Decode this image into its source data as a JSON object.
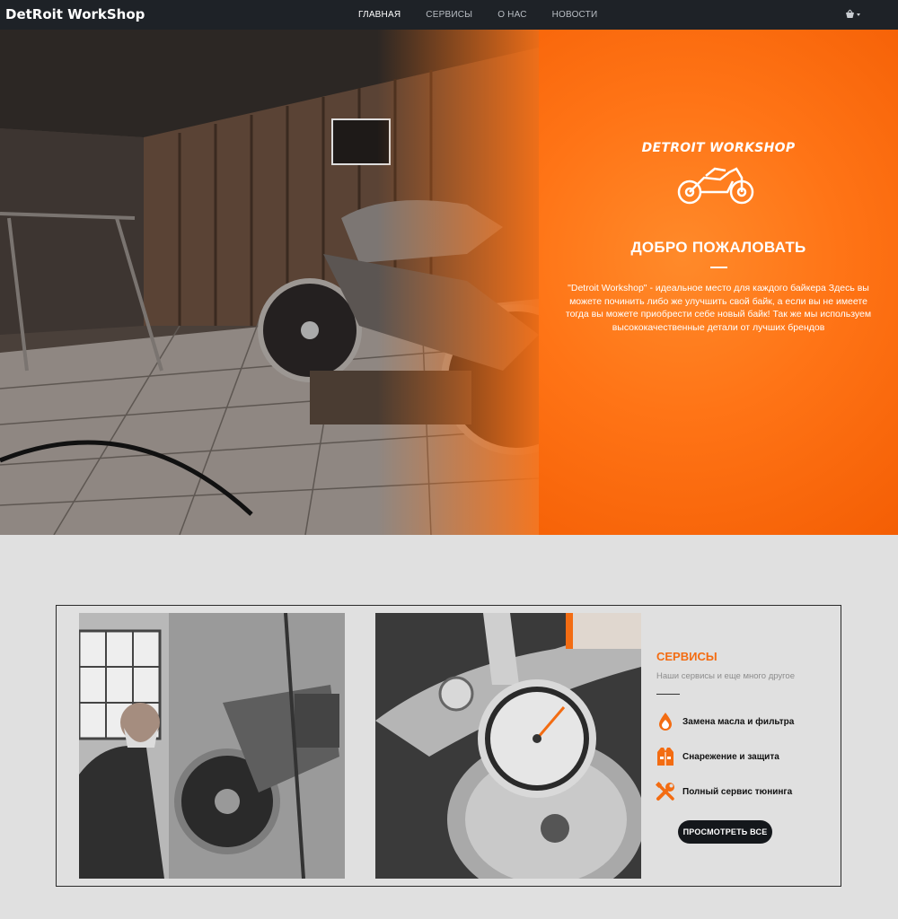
{
  "nav": {
    "brand": "DetRoit WorkShop",
    "items": [
      "ГЛАВНАЯ",
      "СЕРВИСЫ",
      "О НАС",
      "НОВОСТИ"
    ],
    "cart_icon": "basket-icon"
  },
  "hero": {
    "logo_text": "DETROIT WORKSHOP",
    "title": "ДОБРО ПОЖАЛОВАТЬ",
    "text": "\"Detroit Workshop\" - идеальное место для каждого байкера Здесь вы можете починить либо же улучшить свой байк, а если вы не имеете тогда вы можете приобрести себе новый байк! Так же мы используем высококачественные детали от лучших брендов",
    "accent": "#ff7416"
  },
  "services": {
    "title": "СЕРВИСЫ",
    "subtitle": "Наши сервисы и еще много другое",
    "items": [
      {
        "label": "Замена масла и фильтра",
        "icon": "oil-drop-icon"
      },
      {
        "label": "Снарежение и защита",
        "icon": "vest-icon"
      },
      {
        "label": "Полный сервис тюнинга",
        "icon": "tools-icon"
      }
    ],
    "button": "ПРОСМОТРЕТЬ ВСЕ",
    "accent": "#f36c12"
  }
}
